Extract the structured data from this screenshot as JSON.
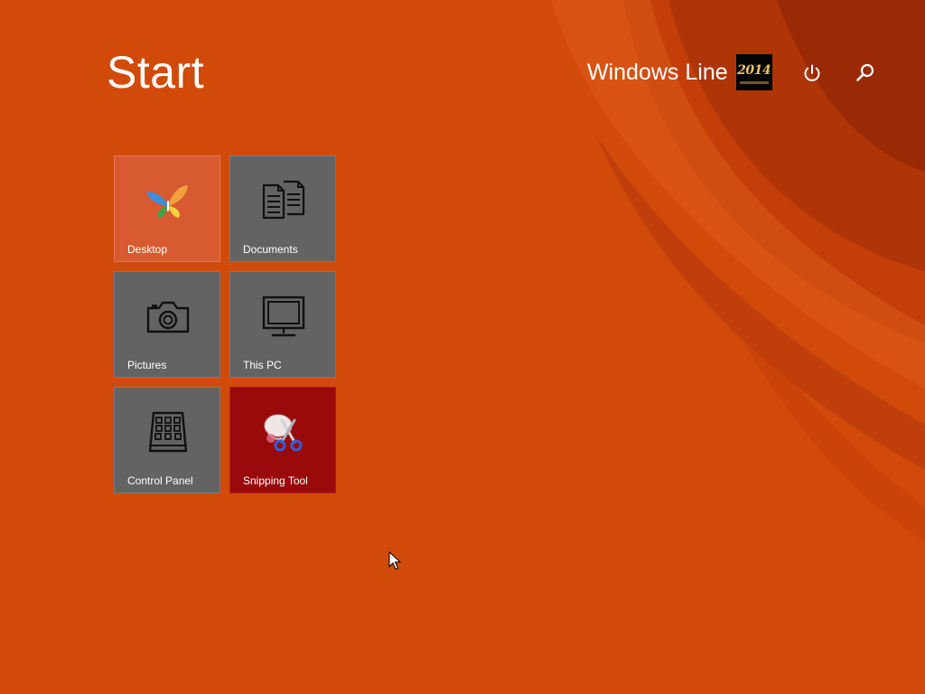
{
  "start": {
    "title": "Start"
  },
  "user": {
    "name": "Windows Line",
    "avatar_text": "2014"
  },
  "header_icons": [
    "power-icon",
    "search-icon"
  ],
  "colors": {
    "background": "#d24a0a",
    "tile_gray": "#636363",
    "tile_desktop": "#d85a30",
    "tile_snipping": "#9a0a0a",
    "text": "#ffffff"
  },
  "tiles": [
    {
      "label": "Desktop",
      "icon": "butterfly-icon"
    },
    {
      "label": "Documents",
      "icon": "documents-icon"
    },
    {
      "label": "Pictures",
      "icon": "camera-icon"
    },
    {
      "label": "This PC",
      "icon": "monitor-icon"
    },
    {
      "label": "Control Panel",
      "icon": "control-panel-icon"
    },
    {
      "label": "Snipping Tool",
      "icon": "scissors-icon"
    }
  ]
}
